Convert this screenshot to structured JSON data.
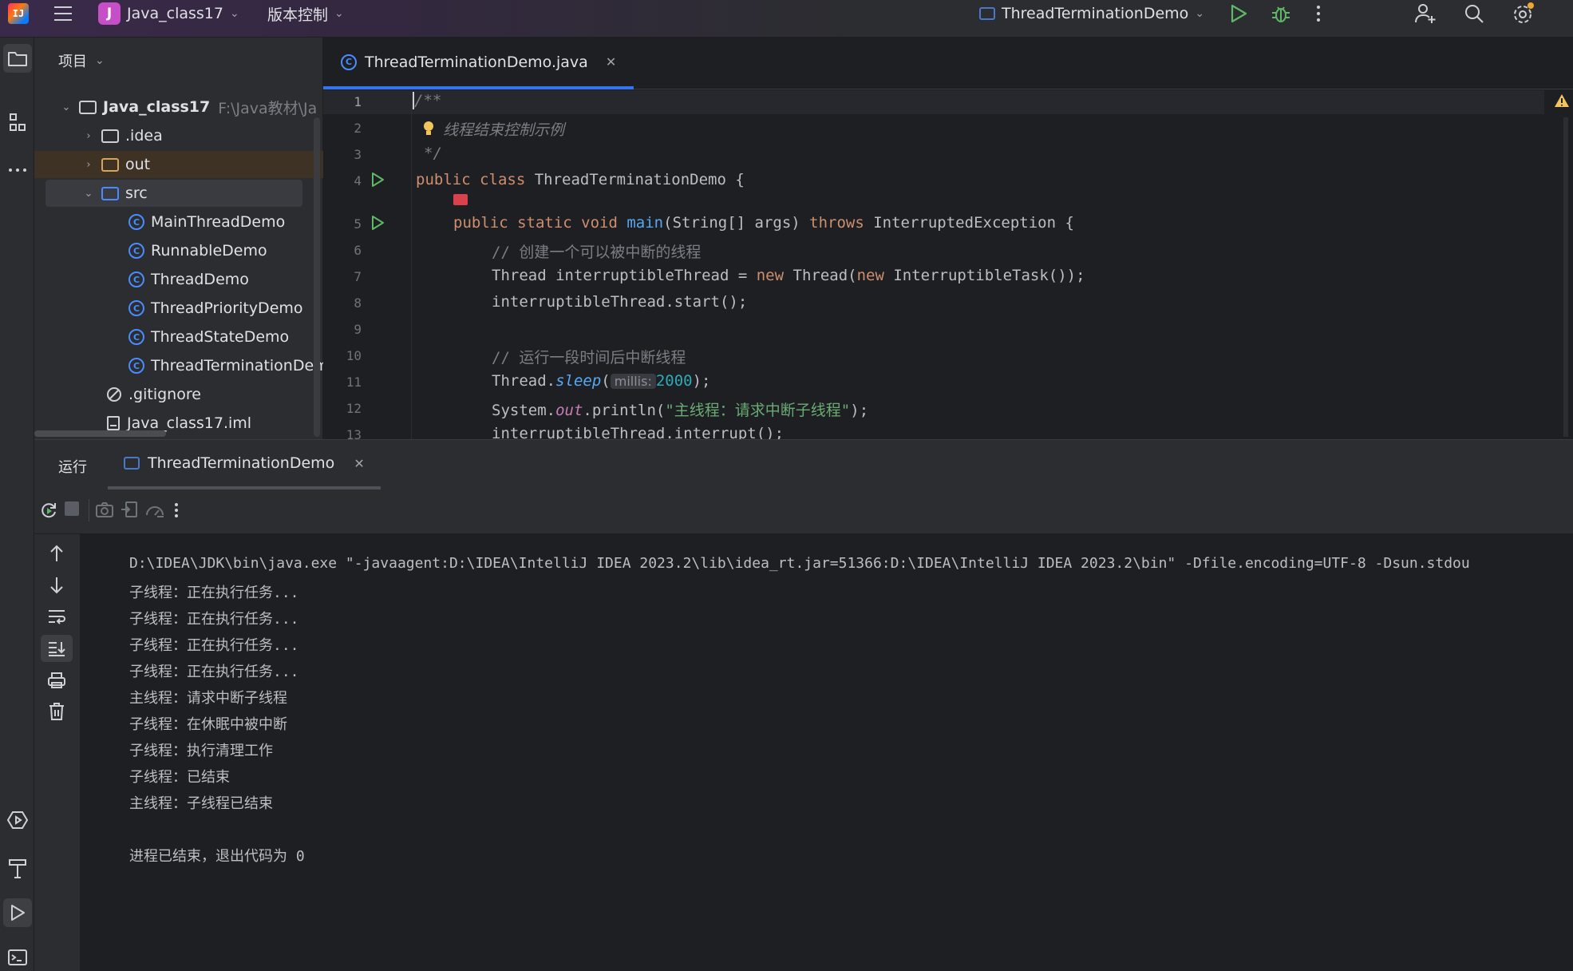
{
  "titlebar": {
    "project_badge": "J",
    "project_name": "Java_class17",
    "vcs_label": "版本控制",
    "run_config": "ThreadTerminationDemo"
  },
  "project_panel": {
    "title": "项目",
    "root_name": "Java_class17",
    "root_path": "F:\\Java教材\\Ja",
    "items": [
      {
        "label": ".idea"
      },
      {
        "label": "out"
      },
      {
        "label": "src"
      },
      {
        "label": "MainThreadDemo"
      },
      {
        "label": "RunnableDemo"
      },
      {
        "label": "ThreadDemo"
      },
      {
        "label": "ThreadPriorityDemo"
      },
      {
        "label": "ThreadStateDemo"
      },
      {
        "label": "ThreadTerminationDem"
      },
      {
        "label": ".gitignore"
      },
      {
        "label": "Java_class17.iml"
      }
    ]
  },
  "editor": {
    "tab_label": "ThreadTerminationDemo.java",
    "line_numbers": [
      "1",
      "2",
      "3",
      "4",
      "5",
      "6",
      "7",
      "8",
      "9",
      "10",
      "11",
      "12",
      "13"
    ],
    "code": {
      "l1": "/**",
      "l2": "线程结束控制示例",
      "l3": "*/",
      "l4_kw": "public class",
      "l4_name": " ThreadTerminationDemo {",
      "l5_kw1": "public static void",
      "l5_fn": "main",
      "l5_mid": "(String[] args) ",
      "l5_kw2": "throws",
      "l5_end": " InterruptedException {",
      "l6": "// 创建一个可以被中断的线程",
      "l7_a": "Thread interruptibleThread = ",
      "l7_kw1": "new",
      "l7_b": " Thread(",
      "l7_kw2": "new",
      "l7_c": " InterruptibleTask());",
      "l8": "interruptibleThread.start();",
      "l10": "// 运行一段时间后中断线程",
      "l11_a": "Thread.",
      "l11_fn": "sleep",
      "l11_b": "(",
      "l11_hint": "millis:",
      "l11_num": "2000",
      "l11_c": ");",
      "l12_a": "System.",
      "l12_out": "out",
      "l12_b": ".println(",
      "l12_str": "\"主线程：请求中断子线程\"",
      "l12_c": ");",
      "l13": "interruptibleThread.interrupt();"
    }
  },
  "run_panel": {
    "title": "运行",
    "tab_label": "ThreadTerminationDemo",
    "console": [
      "D:\\IDEA\\JDK\\bin\\java.exe \"-javaagent:D:\\IDEA\\IntelliJ IDEA 2023.2\\lib\\idea_rt.jar=51366:D:\\IDEA\\IntelliJ IDEA 2023.2\\bin\" -Dfile.encoding=UTF-8 -Dsun.stdou",
      "子线程：正在执行任务...",
      "子线程：正在执行任务...",
      "子线程：正在执行任务...",
      "子线程：正在执行任务...",
      "主线程：请求中断子线程",
      "子线程：在休眠中被中断",
      "子线程：执行清理工作",
      "子线程：已结束",
      "主线程：子线程已结束",
      "",
      "进程已结束，退出代码为 0"
    ]
  },
  "colors": {
    "accent": "#3574f0",
    "run_green": "#5fb865",
    "keyword": "#cf8e6d",
    "function": "#56a8f5",
    "string": "#6aab73",
    "number": "#2aacb8"
  },
  "icons": [
    "intellij-logo-icon",
    "hamburger-menu-icon",
    "chevron-down-icon",
    "run-icon",
    "debug-icon",
    "more-vert-icon",
    "add-user-icon",
    "search-icon",
    "settings-icon",
    "folder-icon",
    "structure-icon",
    "more-horiz-icon",
    "class-icon",
    "gitignore-icon",
    "file-icon",
    "bulb-icon",
    "warning-icon",
    "rerun-icon",
    "stop-icon",
    "camera-icon",
    "import-icon",
    "profiler-icon",
    "arrow-up-icon",
    "arrow-down-icon",
    "soft-wrap-icon",
    "scroll-end-icon",
    "print-icon",
    "trash-icon",
    "services-icon",
    "build-icon",
    "terminal-icon"
  ]
}
